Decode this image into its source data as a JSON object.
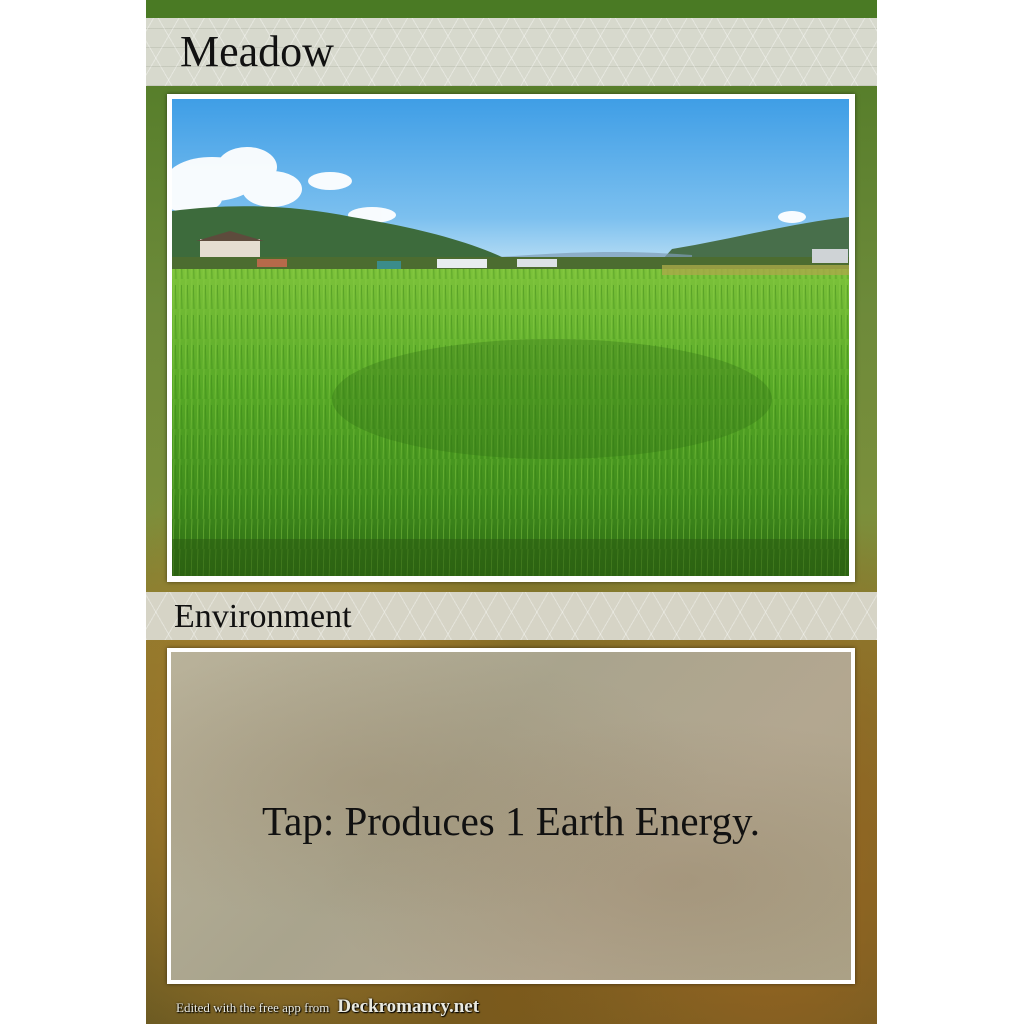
{
  "card": {
    "title": "Meadow",
    "type_line": "Environment",
    "rules_text": "Tap: Produces 1 Earth Energy.",
    "artwork": "rice-field-landscape",
    "colors": {
      "frame_green": "#4a7a24",
      "title_bar": "#d7d9cd",
      "text_box": "#aea58a"
    }
  },
  "footer": {
    "prefix": "Edited with the free app from",
    "brand": "Deckromancy.net"
  }
}
